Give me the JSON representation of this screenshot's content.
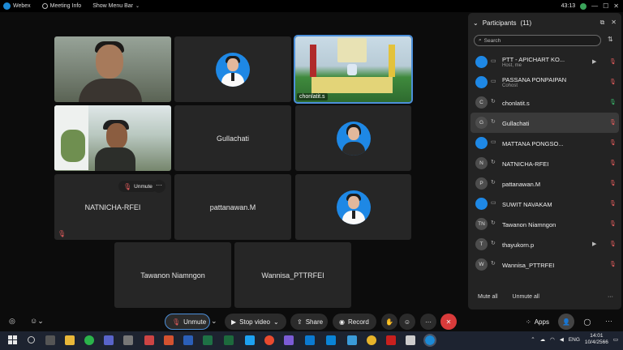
{
  "topbar": {
    "app_name": "Webex",
    "meeting_info": "Meeting Info",
    "show_menu_bar": "Show Menu Bar",
    "timer": "43:13",
    "minimize": "—",
    "maximize": "☐",
    "close": "✕"
  },
  "tiles": {
    "t2_name": "",
    "t3_name": "chonlatit.s",
    "t5_name": "Gullachati",
    "t7_name": "NATNICHA-RFEI",
    "t7_unmute": "Unmute",
    "t7_more": "···",
    "t8_name": "pattanawan.M",
    "t10_name": "Tawanon Niamngon",
    "t11_name": "Wannisa_PTTRFEI"
  },
  "participants": {
    "title": "Participants",
    "count": "(11)",
    "search_placeholder": "Search",
    "rows": [
      {
        "name": "PTT - APICHART KO...",
        "sub": "Host, me",
        "initial": ""
      },
      {
        "name": "PASSANA PONPAIPAN",
        "sub": "Cohost",
        "initial": ""
      },
      {
        "name": "chonlatit.s",
        "sub": "",
        "initial": "C"
      },
      {
        "name": "Gullachati",
        "sub": "",
        "initial": "G"
      },
      {
        "name": "MATTANA PONGSO...",
        "sub": "",
        "initial": ""
      },
      {
        "name": "NATNICHA-RFEI",
        "sub": "",
        "initial": "N"
      },
      {
        "name": "pattanawan.M",
        "sub": "",
        "initial": "P"
      },
      {
        "name": "SUWIT NAVAKAM",
        "sub": "",
        "initial": ""
      },
      {
        "name": "Tawanon Niamngon",
        "sub": "",
        "initial": "TN"
      },
      {
        "name": "thayukorn.p",
        "sub": "",
        "initial": "T"
      },
      {
        "name": "Wannisa_PTTRFEI",
        "sub": "",
        "initial": "W"
      }
    ],
    "mute_all": "Mute all",
    "unmute_all": "Unmute all",
    "more": "···"
  },
  "controls": {
    "unmute": "Unmute",
    "stop_video": "Stop video",
    "share": "Share",
    "record": "Record",
    "apps": "Apps"
  },
  "taskbar": {
    "lang": "ENG",
    "time": "14:01",
    "date": "10/4/2566"
  },
  "colors": {
    "accent": "#4c8fd9",
    "end_call": "#d93b3b",
    "muted": "#e25c5c",
    "speaking": "#39b56a"
  }
}
